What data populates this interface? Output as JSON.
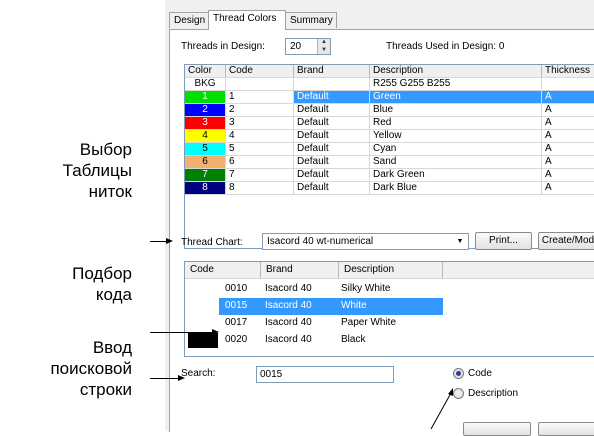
{
  "callouts": {
    "thread_chart": [
      "Выбор",
      "Таблицы",
      "ниток"
    ],
    "code_match": [
      "Подбор",
      "кода"
    ],
    "search_entry": [
      "Ввод",
      "поисковой",
      "строки"
    ]
  },
  "tabs": [
    {
      "label": "Design"
    },
    {
      "label": "Thread Colors"
    },
    {
      "label": "Summary"
    }
  ],
  "threads": {
    "in_design_label": "Threads in Design:",
    "in_design_value": "20",
    "used_label": "Threads Used in Design: 0"
  },
  "thread_grid": {
    "headers": [
      "Color",
      "Code",
      "Brand",
      "Description",
      "Thickness"
    ],
    "rows": [
      {
        "color": "BKG",
        "code": "",
        "brand": "",
        "desc": "R255 G255 B255",
        "thick": "",
        "swatch": "#ffffff",
        "text_color": "#000000"
      },
      {
        "color": "1",
        "code": "1",
        "brand": "Default",
        "desc": "Green",
        "thick": "A",
        "swatch": "#00e000",
        "text_color": "#ffffff"
      },
      {
        "color": "2",
        "code": "2",
        "brand": "Default",
        "desc": "Blue",
        "thick": "A",
        "swatch": "#0000ff",
        "text_color": "#ffffff"
      },
      {
        "color": "3",
        "code": "3",
        "brand": "Default",
        "desc": "Red",
        "thick": "A",
        "swatch": "#ff0000",
        "text_color": "#ffffff"
      },
      {
        "color": "4",
        "code": "4",
        "brand": "Default",
        "desc": "Yellow",
        "thick": "A",
        "swatch": "#ffff00",
        "text_color": "#000000"
      },
      {
        "color": "5",
        "code": "5",
        "brand": "Default",
        "desc": "Cyan",
        "thick": "A",
        "swatch": "#00ffff",
        "text_color": "#000000"
      },
      {
        "color": "6",
        "code": "6",
        "brand": "Default",
        "desc": "Sand",
        "thick": "A",
        "swatch": "#f0b070",
        "text_color": "#000000"
      },
      {
        "color": "7",
        "code": "7",
        "brand": "Default",
        "desc": "Dark Green",
        "thick": "A",
        "swatch": "#008000",
        "text_color": "#ffffff"
      },
      {
        "color": "8",
        "code": "8",
        "brand": "Default",
        "desc": "Dark Blue",
        "thick": "A",
        "swatch": "#000080",
        "text_color": "#ffffff"
      }
    ]
  },
  "thread_chart": {
    "label": "Thread Chart:",
    "selected": "Isacord 40 wt-numerical",
    "print_label": "Print...",
    "create_label": "Create/Modify"
  },
  "match_list": {
    "headers": [
      "Code",
      "Brand",
      "Description"
    ],
    "rows": [
      {
        "code": "0010",
        "brand": "Isacord 40",
        "desc": "Silky White",
        "swatch": "#ffffff",
        "selected": false
      },
      {
        "code": "0015",
        "brand": "Isacord 40",
        "desc": "White",
        "swatch": "#ffffff",
        "selected": true
      },
      {
        "code": "0017",
        "brand": "Isacord 40",
        "desc": "Paper White",
        "swatch": "#ffffff",
        "selected": false
      },
      {
        "code": "0020",
        "brand": "Isacord 40",
        "desc": "Black",
        "swatch": "#000000",
        "selected": false
      }
    ]
  },
  "search": {
    "label": "Search:",
    "value": "0015",
    "options": [
      {
        "label": "Code",
        "selected": true
      },
      {
        "label": "Description",
        "selected": false
      }
    ]
  },
  "colors": {
    "selection": "#3399ff",
    "field_border": "#7f9db9"
  }
}
